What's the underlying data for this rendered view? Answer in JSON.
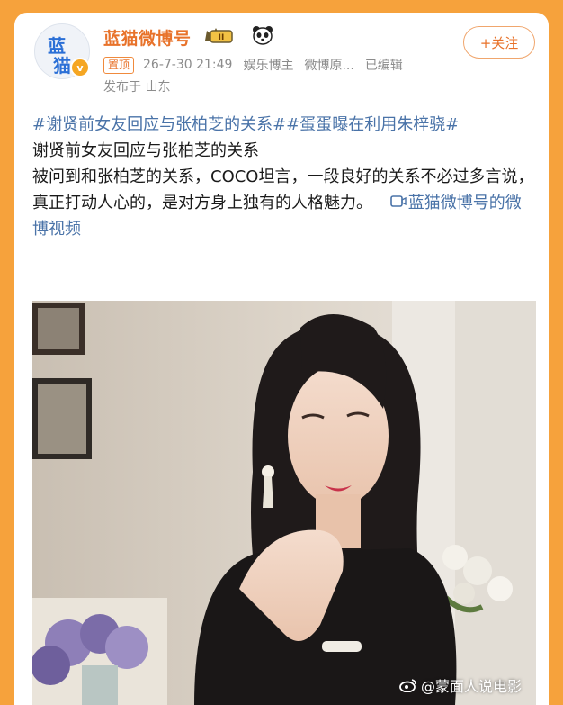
{
  "post": {
    "author": "蓝猫微博号",
    "avatar_text": [
      "蓝",
      "猫"
    ],
    "level_badge": "II",
    "follow_label": "+关注",
    "pinned": "置顶",
    "date": "26-7-30 21:49",
    "role": "娱乐博主",
    "source": "微博原...",
    "edited": "已编辑",
    "location": "发布于 山东"
  },
  "content": {
    "topics": "#谢贤前女友回应与张柏芝的关系##蛋蛋曝在利用朱梓骁#",
    "line1": "谢贤前女友回应与张柏芝的关系",
    "line2": "被问到和张柏芝的关系，COCO坦言，一段良好的关系不必过多言说，真正打动人心的，是对方身上独有的人格魅力。",
    "video_link": "蓝猫微博号的微博视频"
  },
  "watermark": "@蒙面人说电影",
  "icons": [
    "crown-level-icon",
    "panda-icon",
    "verified-icon",
    "video-link-icon",
    "weibo-logo-icon"
  ],
  "colors": {
    "accent_orange": "#e8722a",
    "topic_blue": "#4a73a8",
    "frame_orange": "#f6a23c"
  }
}
